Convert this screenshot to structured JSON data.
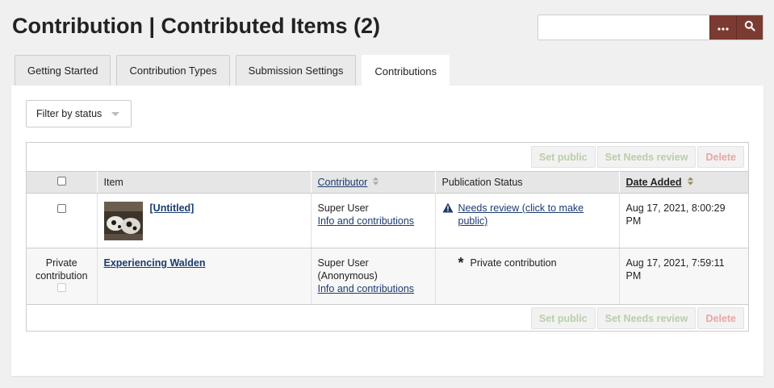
{
  "header": {
    "title": "Contribution | Contributed Items (2)",
    "search": {
      "value": "",
      "placeholder": ""
    }
  },
  "tabs": [
    {
      "label": "Getting Started",
      "active": false
    },
    {
      "label": "Contribution Types",
      "active": false
    },
    {
      "label": "Submission Settings",
      "active": false
    },
    {
      "label": "Contributions",
      "active": true
    }
  ],
  "filter": {
    "label": "Filter by status"
  },
  "actions": {
    "set_public": "Set public",
    "set_needs_review": "Set Needs review",
    "delete": "Delete"
  },
  "table": {
    "columns": {
      "item": "Item",
      "contributor": "Contributor",
      "publication_status": "Publication Status",
      "date_added": "Date Added"
    },
    "rows": [
      {
        "item_title": "[Untitled]",
        "has_thumbnail": true,
        "contributor": "Super User",
        "contributor_link": "Info and contributions",
        "status": "Needs review (click to make public)",
        "date": "Aug 17, 2021, 8:00:29 PM"
      },
      {
        "private_label": "Private contribution",
        "item_title": "Experiencing Walden",
        "contributor": "Super User",
        "contributor_note": "(Anonymous)",
        "contributor_link": "Info and contributions",
        "status": "Private contribution",
        "date": "Aug 17, 2021, 7:59:11 PM"
      }
    ]
  },
  "colors": {
    "background": "#f0f0f0",
    "accent": "#7b3b33",
    "link": "#1b3b6f",
    "action_green": "#b9cfa8",
    "action_red": "#e8a7a4"
  },
  "icons": {
    "search_options": "ellipsis-icon",
    "search_submit": "search-icon",
    "needs_review": "warning-icon",
    "private": "asterisk-icon",
    "sort": "sort-icon"
  }
}
